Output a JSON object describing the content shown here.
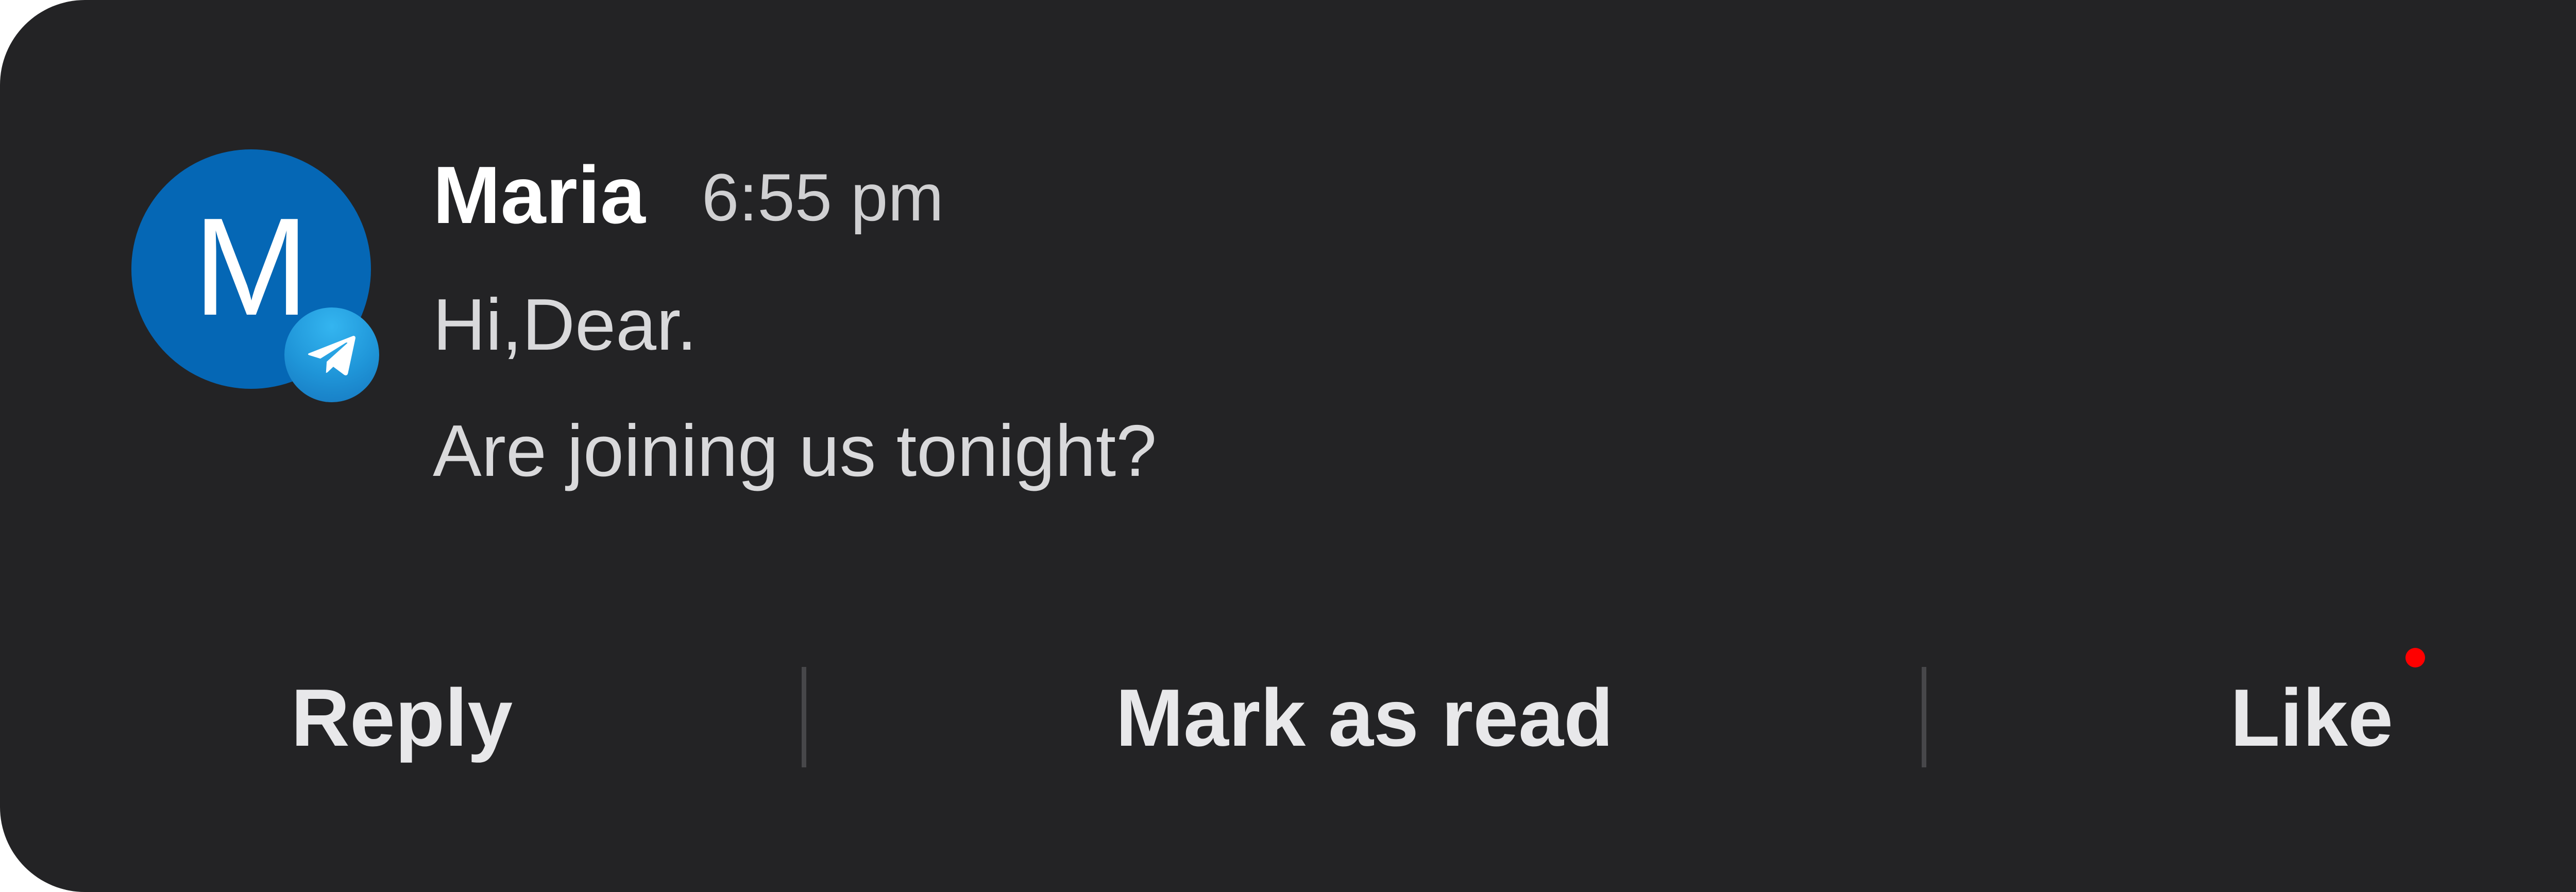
{
  "notification": {
    "avatar_letter": "M",
    "avatar_color": "#0567b5",
    "app_badge_icon": "telegram-paper-plane-icon",
    "app_badge_color": "#229ED9",
    "sender": "Maria",
    "time": "6:55 pm",
    "message_lines": [
      "Hi,Dear.",
      "Are joining us tonight?"
    ]
  },
  "actions": {
    "reply_label": "Reply",
    "mark_read_label": "Mark as read",
    "like_label": "Like",
    "unread_dot_color": "#ff0000"
  },
  "colors": {
    "card_background": "#232325"
  }
}
